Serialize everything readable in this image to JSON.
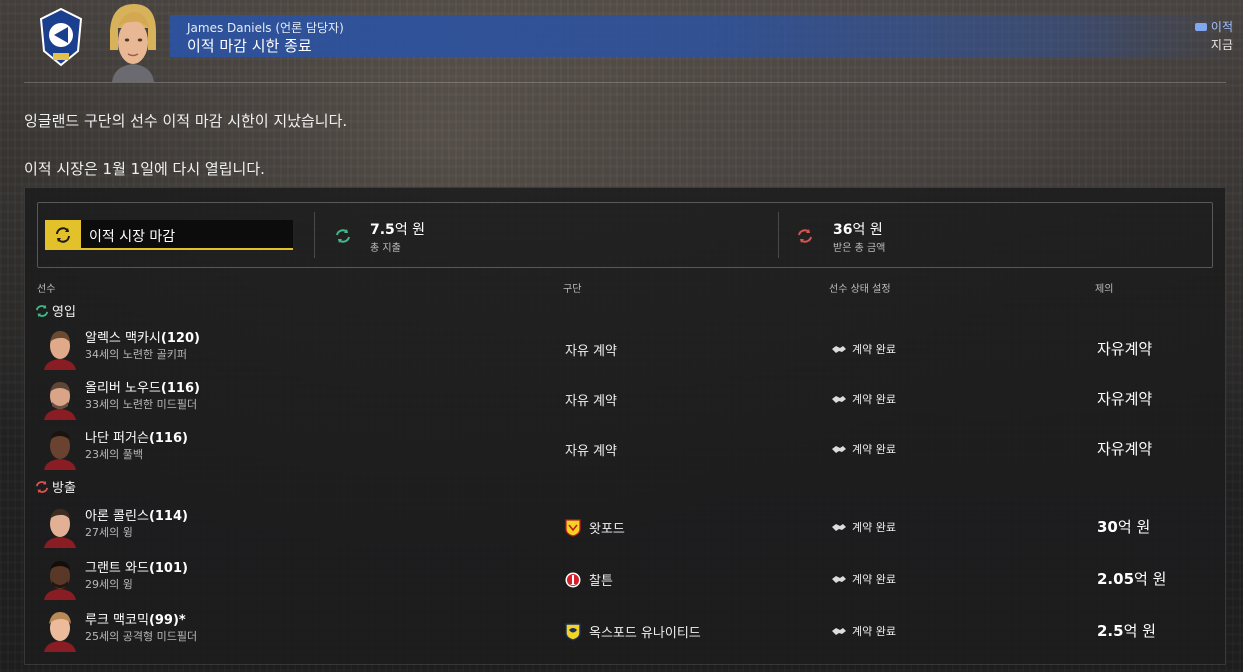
{
  "header": {
    "sender_name": "James Daniels",
    "sender_role": "(언론 담당자)",
    "subject": "이적 마감 시한 종료",
    "tag": "이적",
    "time": "지금"
  },
  "message": {
    "line1": "잉글랜드 구단의 선수 이적 마감 시한이 지났습니다.",
    "line2": "이적 시장은 1월 1일에 다시 열립니다."
  },
  "summary": {
    "badge_label": "이적 시장 마감",
    "spent_value": "7.5",
    "spent_unit": "억 원",
    "spent_label": "총 지출",
    "received_value": "36",
    "received_unit": "억 원",
    "received_label": "받은 총 금액"
  },
  "columns": {
    "player": "선수",
    "club": "구단",
    "status": "선수 상태 설정",
    "fee": "제의"
  },
  "sections": {
    "incoming": "영입",
    "outgoing": "방출"
  },
  "incoming": [
    {
      "name": "알렉스 맥카시",
      "rating": "(120)",
      "desc": "34세의 노련한 골키퍼",
      "club": "자유 계약",
      "status": "계약 완료",
      "fee": "자유계약",
      "fee_unit": ""
    },
    {
      "name": "올리버 노우드",
      "rating": "(116)",
      "desc": "33세의 노련한 미드필더",
      "club": "자유 계약",
      "status": "계약 완료",
      "fee": "자유계약",
      "fee_unit": ""
    },
    {
      "name": "나단 퍼거슨",
      "rating": "(116)",
      "desc": "23세의 풀백",
      "club": "자유 계약",
      "status": "계약 완료",
      "fee": "자유계약",
      "fee_unit": ""
    }
  ],
  "outgoing": [
    {
      "name": "아론 콜린스",
      "rating": "(114)",
      "desc": "27세의 윙",
      "club": "왓포드",
      "club_icon": "watford-crest-icon",
      "status": "계약 완료",
      "fee": "30",
      "fee_unit": "억 원"
    },
    {
      "name": "그랜트 와드",
      "rating": "(101)",
      "desc": "29세의 윙",
      "club": "찰튼",
      "club_icon": "charlton-crest-icon",
      "status": "계약 완료",
      "fee": "2.05",
      "fee_unit": "억 원"
    },
    {
      "name": "루크 맥코믹",
      "rating": "(99)*",
      "desc": "25세의 공격형 미드필더",
      "club": "옥스포드 유나이티드",
      "club_icon": "oxford-crest-icon",
      "status": "계약 완료",
      "fee": "2.5",
      "fee_unit": "억 원"
    }
  ],
  "colors": {
    "accent_yellow": "#e2c12a",
    "header_blue": "#2c52a0",
    "incoming_green": "#3fb98a",
    "outgoing_red": "#d9534f"
  }
}
